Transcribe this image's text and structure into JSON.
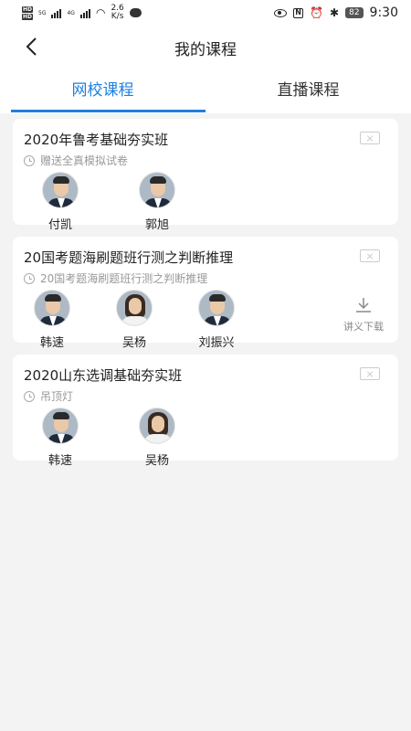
{
  "status_bar": {
    "hd_top": "HD",
    "hd_bottom": "HD",
    "net_5g": "5G",
    "net_4g": "4G",
    "speed_value": "2.6",
    "speed_unit": "K/s",
    "nfc": "N",
    "battery": "82",
    "time": "9:30"
  },
  "header": {
    "title": "我的课程"
  },
  "tabs": [
    {
      "label": "网校课程",
      "active": true
    },
    {
      "label": "直播课程",
      "active": false
    }
  ],
  "courses": [
    {
      "title": "2020年鲁考基础夯实班",
      "subtitle": "赠送全真模拟试卷",
      "teachers": [
        {
          "name": "付凯",
          "gender": "male"
        },
        {
          "name": "郭旭",
          "gender": "male"
        }
      ]
    },
    {
      "title": "20国考题海刷题班行测之判断推理",
      "subtitle": "20国考题海刷题班行测之判断推理",
      "teachers": [
        {
          "name": "韩速",
          "gender": "male"
        },
        {
          "name": "吴杨",
          "gender": "female"
        },
        {
          "name": "刘振兴",
          "gender": "male"
        }
      ],
      "download_label": "讲义下载"
    },
    {
      "title": "2020山东选调基础夯实班",
      "subtitle": "吊顶灯",
      "teachers": [
        {
          "name": "韩速",
          "gender": "male"
        },
        {
          "name": "吴杨",
          "gender": "female"
        }
      ]
    }
  ],
  "colors": {
    "accent": "#1e7fe0",
    "background": "#f3f3f3"
  }
}
